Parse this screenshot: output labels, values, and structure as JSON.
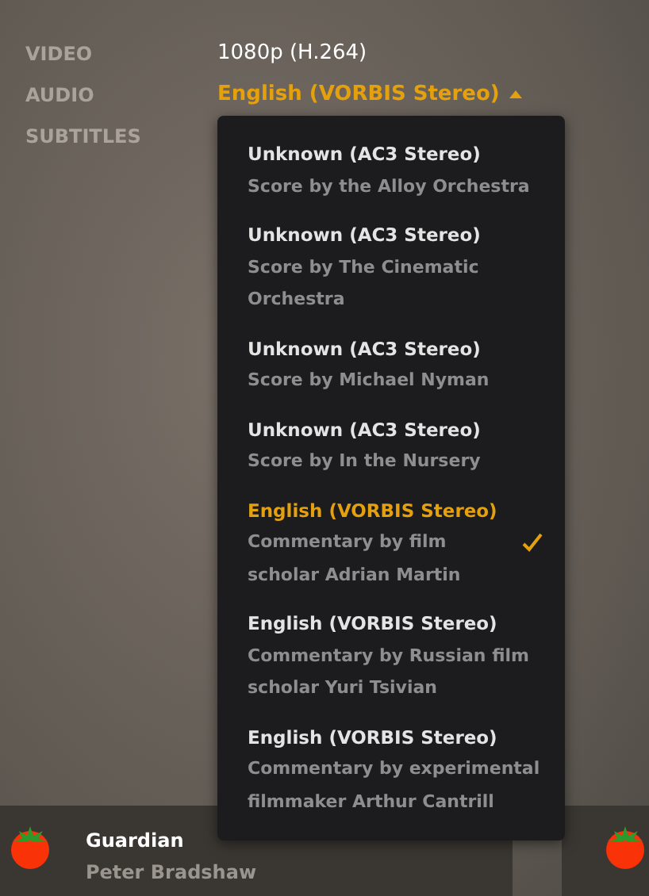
{
  "details": [
    {
      "label": "VIDEO",
      "value": "1080p (H.264)",
      "kind": "text"
    },
    {
      "label": "AUDIO",
      "value": "English (VORBIS Stereo)",
      "kind": "dropdown",
      "expanded": true
    },
    {
      "label": "SUBTITLES",
      "kind": "empty"
    }
  ],
  "audio_menu": {
    "items": [
      {
        "title": "Unknown (AC3 Stereo)",
        "subtitle": "Score by the Alloy Orchestra",
        "selected": false
      },
      {
        "title": "Unknown (AC3 Stereo)",
        "subtitle": "Score by The Cinematic Orchestra",
        "selected": false
      },
      {
        "title": "Unknown (AC3 Stereo)",
        "subtitle": "Score by Michael Nyman",
        "selected": false
      },
      {
        "title": "Unknown (AC3 Stereo)",
        "subtitle": "Score by In the Nursery",
        "selected": false
      },
      {
        "title": "English (VORBIS Stereo)",
        "subtitle": "Commentary by film scholar Adrian Martin",
        "selected": true
      },
      {
        "title": "English (VORBIS Stereo)",
        "subtitle": "Commentary by Russian film scholar Yuri Tsivian",
        "selected": false
      },
      {
        "title": "English (VORBIS Stereo)",
        "subtitle": "Commentary by experimental filmmaker Arthur Cantrill",
        "selected": false
      }
    ]
  },
  "reviews": [
    {
      "kind": "full",
      "source": "Guardian",
      "critic": "Peter Bradshaw"
    },
    {
      "kind": "cut_off"
    }
  ]
}
